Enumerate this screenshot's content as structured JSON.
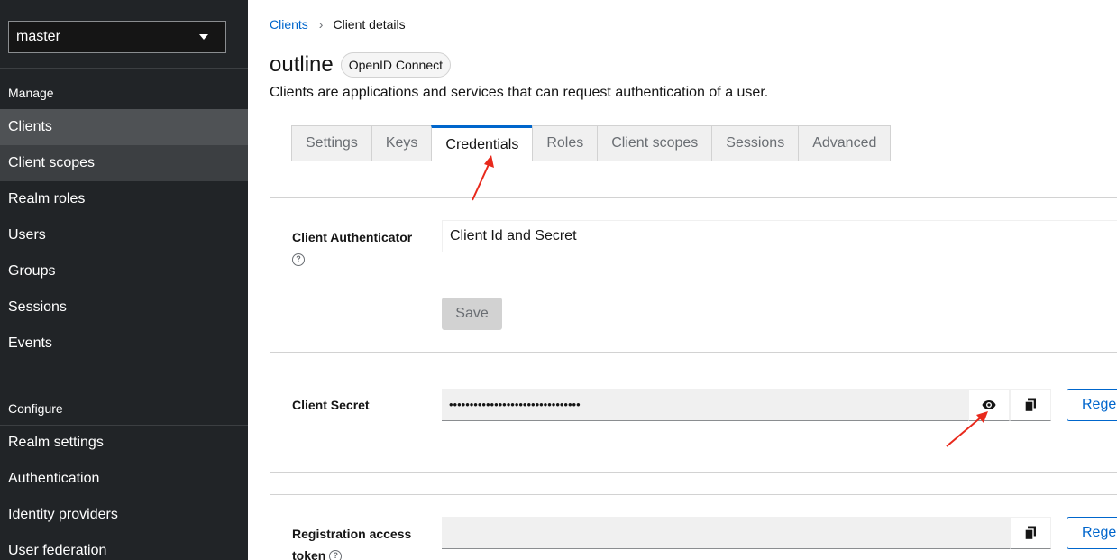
{
  "sidebar": {
    "realm": "master",
    "sections": [
      {
        "title": "Manage"
      },
      {
        "title": "Configure"
      }
    ],
    "manage_items": [
      {
        "label": "Clients"
      },
      {
        "label": "Client scopes"
      },
      {
        "label": "Realm roles"
      },
      {
        "label": "Users"
      },
      {
        "label": "Groups"
      },
      {
        "label": "Sessions"
      },
      {
        "label": "Events"
      }
    ],
    "configure_items": [
      {
        "label": "Realm settings"
      },
      {
        "label": "Authentication"
      },
      {
        "label": "Identity providers"
      },
      {
        "label": "User federation"
      }
    ]
  },
  "breadcrumb": {
    "parent": "Clients",
    "separator": "›",
    "current": "Client details"
  },
  "header": {
    "title": "outline",
    "badge": "OpenID Connect",
    "description": "Clients are applications and services that can request authentication of a user."
  },
  "tabs": [
    {
      "label": "Settings"
    },
    {
      "label": "Keys"
    },
    {
      "label": "Credentials"
    },
    {
      "label": "Roles"
    },
    {
      "label": "Client scopes"
    },
    {
      "label": "Sessions"
    },
    {
      "label": "Advanced"
    }
  ],
  "active_tab": "Credentials",
  "credentials": {
    "authenticator_label": "Client Authenticator",
    "authenticator_value": "Client Id and Secret",
    "save_label": "Save",
    "secret_label": "Client Secret",
    "secret_value": "••••••••••••••••••••••••••••••••",
    "regenerate_label": "Regenerate",
    "registration_label_line1": "Registration access",
    "registration_label_line2": "token",
    "registration_value": ""
  },
  "colors": {
    "sidebar_bg": "#212427",
    "accent": "#0066cc",
    "annotation": "#e8291c"
  },
  "icons": [
    "help-icon",
    "eye-icon",
    "copy-icon",
    "chevron-down-icon",
    "annotation-arrow"
  ]
}
